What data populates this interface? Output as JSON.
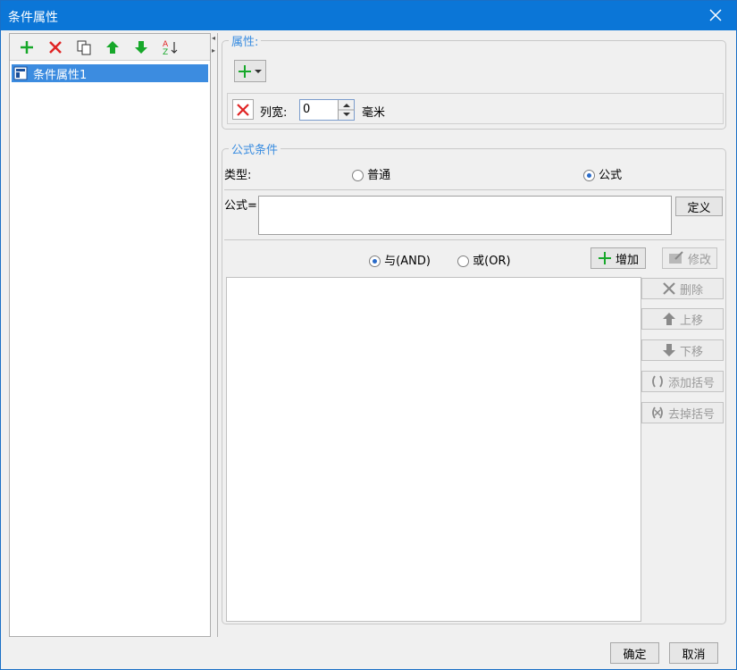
{
  "window": {
    "title": "条件属性"
  },
  "tree": {
    "items": [
      {
        "label": "条件属性1"
      }
    ]
  },
  "properties": {
    "group_title": "属性:",
    "add_symbol": "+",
    "width_label": "列宽:",
    "width_value": "0",
    "width_unit": "毫米"
  },
  "formula_condition": {
    "group_title": "公式条件",
    "type_label": "类型:",
    "type_options": [
      "普通",
      "公式"
    ],
    "type_selected": "公式",
    "formula_label": "公式=",
    "formula_value": "",
    "define_button": "定义",
    "logic_options": [
      "与(AND)",
      "或(OR)"
    ],
    "logic_selected": "与(AND)",
    "add_button": "增加",
    "edit_button": "修改",
    "delete_button": "删除",
    "move_up_button": "上移",
    "move_down_button": "下移",
    "add_bracket_button": "添加括号",
    "remove_bracket_button": "去掉括号"
  },
  "footer": {
    "ok_button": "确定",
    "cancel_button": "取消"
  },
  "colors": {
    "titlebar": "#0b76d7",
    "selection": "#3c8ce0",
    "group_title": "#3a8de0",
    "add_green": "#17a82a",
    "delete_red": "#e02424"
  },
  "icons": {
    "toolbar": [
      "add-icon",
      "delete-icon",
      "copy-icon",
      "move-up-icon",
      "move-down-icon",
      "sort-icon"
    ]
  }
}
